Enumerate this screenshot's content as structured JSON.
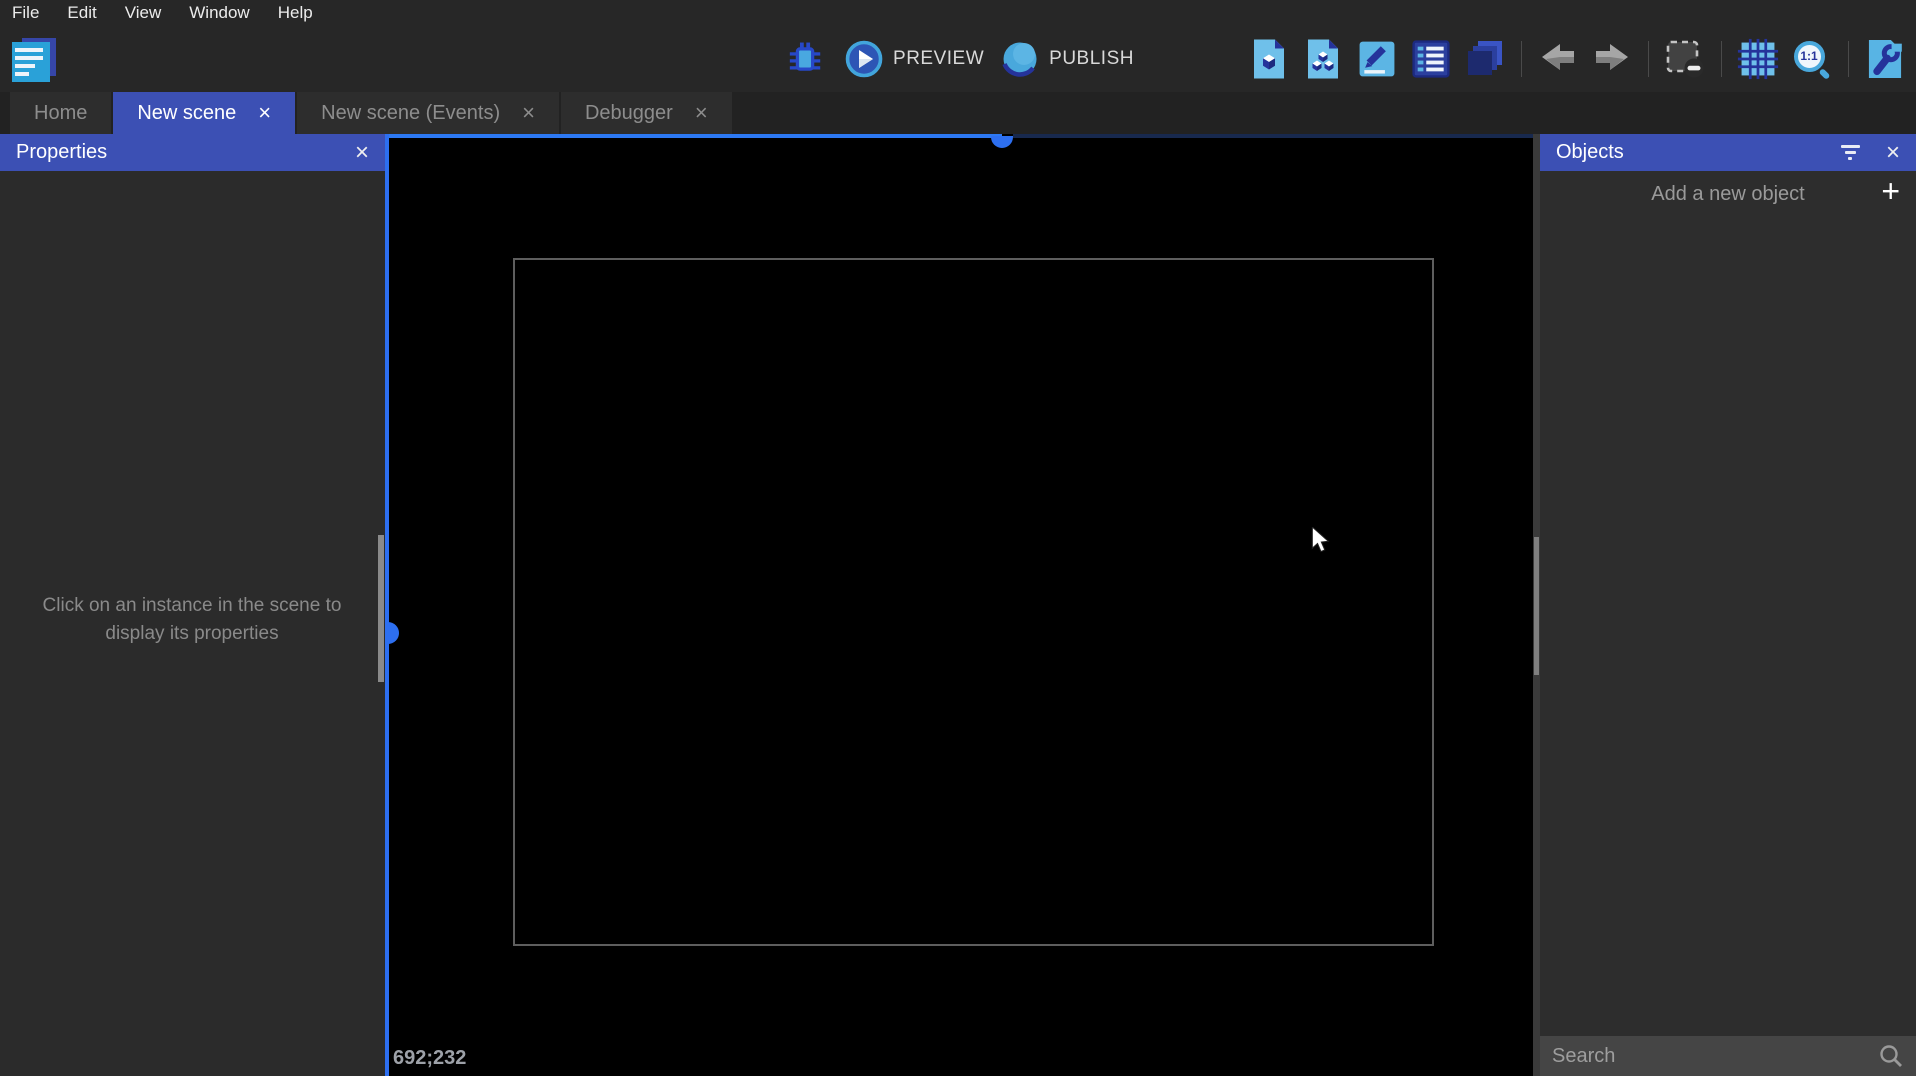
{
  "menu_bar": {
    "items": [
      {
        "label": "File"
      },
      {
        "label": "Edit"
      },
      {
        "label": "View"
      },
      {
        "label": "Window"
      },
      {
        "label": "Help"
      }
    ]
  },
  "toolbar": {
    "preview_label": "PREVIEW",
    "publish_label": "PUBLISH",
    "zoom_badge": "1:1"
  },
  "tabs": {
    "close_glyph": "×",
    "items": [
      {
        "label": "Home",
        "active": false
      },
      {
        "label": "New scene",
        "active": true
      },
      {
        "label": "New scene (Events)",
        "active": false
      },
      {
        "label": "Debugger",
        "active": false
      }
    ]
  },
  "properties_panel": {
    "title": "Properties",
    "close_glyph": "×",
    "empty_message": "Click on an instance in the scene to display its properties"
  },
  "scene_canvas": {
    "coordinates": "692;232"
  },
  "objects_panel": {
    "title": "Objects",
    "close_glyph": "×",
    "add_button_label": "Add a new object",
    "plus_glyph": "+",
    "search_placeholder": "Search"
  },
  "colors": {
    "accent_indigo": "#3c50b4",
    "accent_blue": "#2d79f3",
    "icon_blue_light": "#6fc0ea",
    "icon_blue_dark": "#25339b",
    "canvas_bg": "#000000"
  }
}
